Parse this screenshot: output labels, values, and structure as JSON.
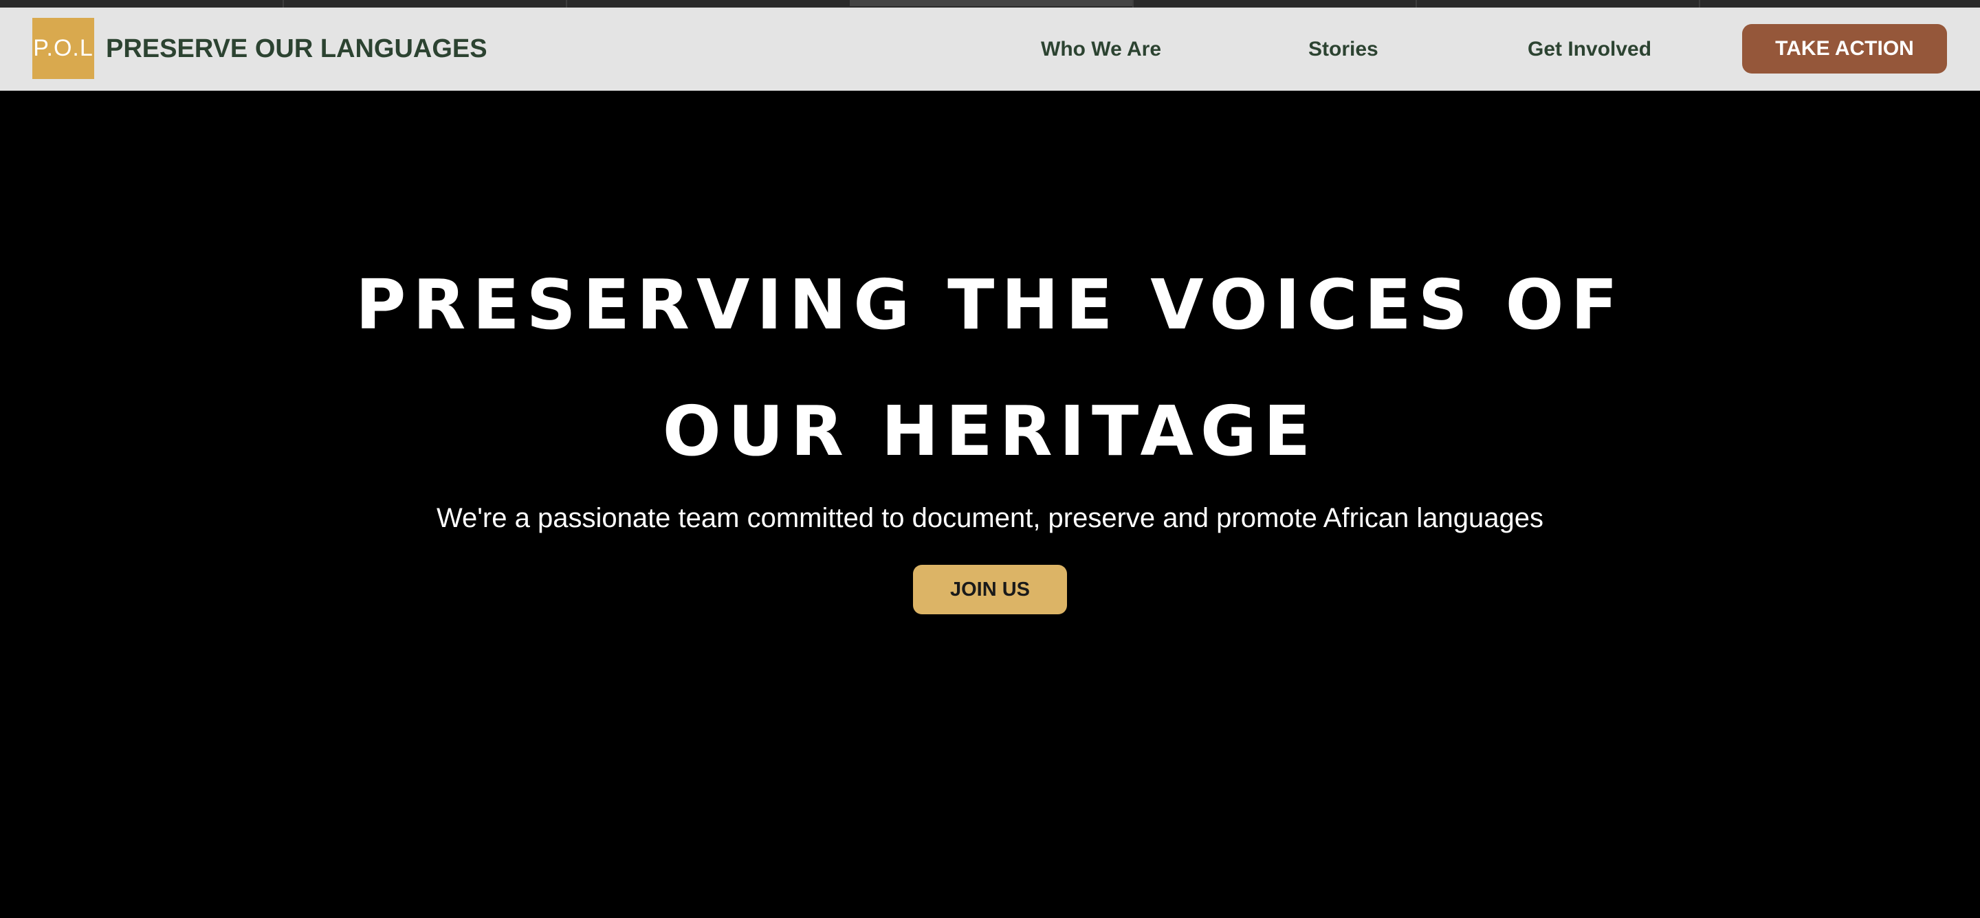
{
  "browser": {
    "tab_count_visible": 7
  },
  "header": {
    "logo_text": "P.O.L",
    "site_title": "PRESERVE OUR LANGUAGES",
    "nav": [
      {
        "label": "Who We Are"
      },
      {
        "label": "Stories"
      },
      {
        "label": "Get Involved"
      }
    ],
    "cta_label": "TAKE ACTION"
  },
  "hero": {
    "title_line1": "Preserving the voices of",
    "title_line2": "our heritage",
    "subtitle": "We're a passionate team committed to document, preserve and promote African languages",
    "button_label": "JOIN US"
  },
  "colors": {
    "navbar_bg": "#e4e4e4",
    "logo_bg": "#d9a94e",
    "nav_text": "#2c4331",
    "cta_bg": "#95573a",
    "hero_bg": "#000000",
    "join_bg": "#dcb466"
  }
}
